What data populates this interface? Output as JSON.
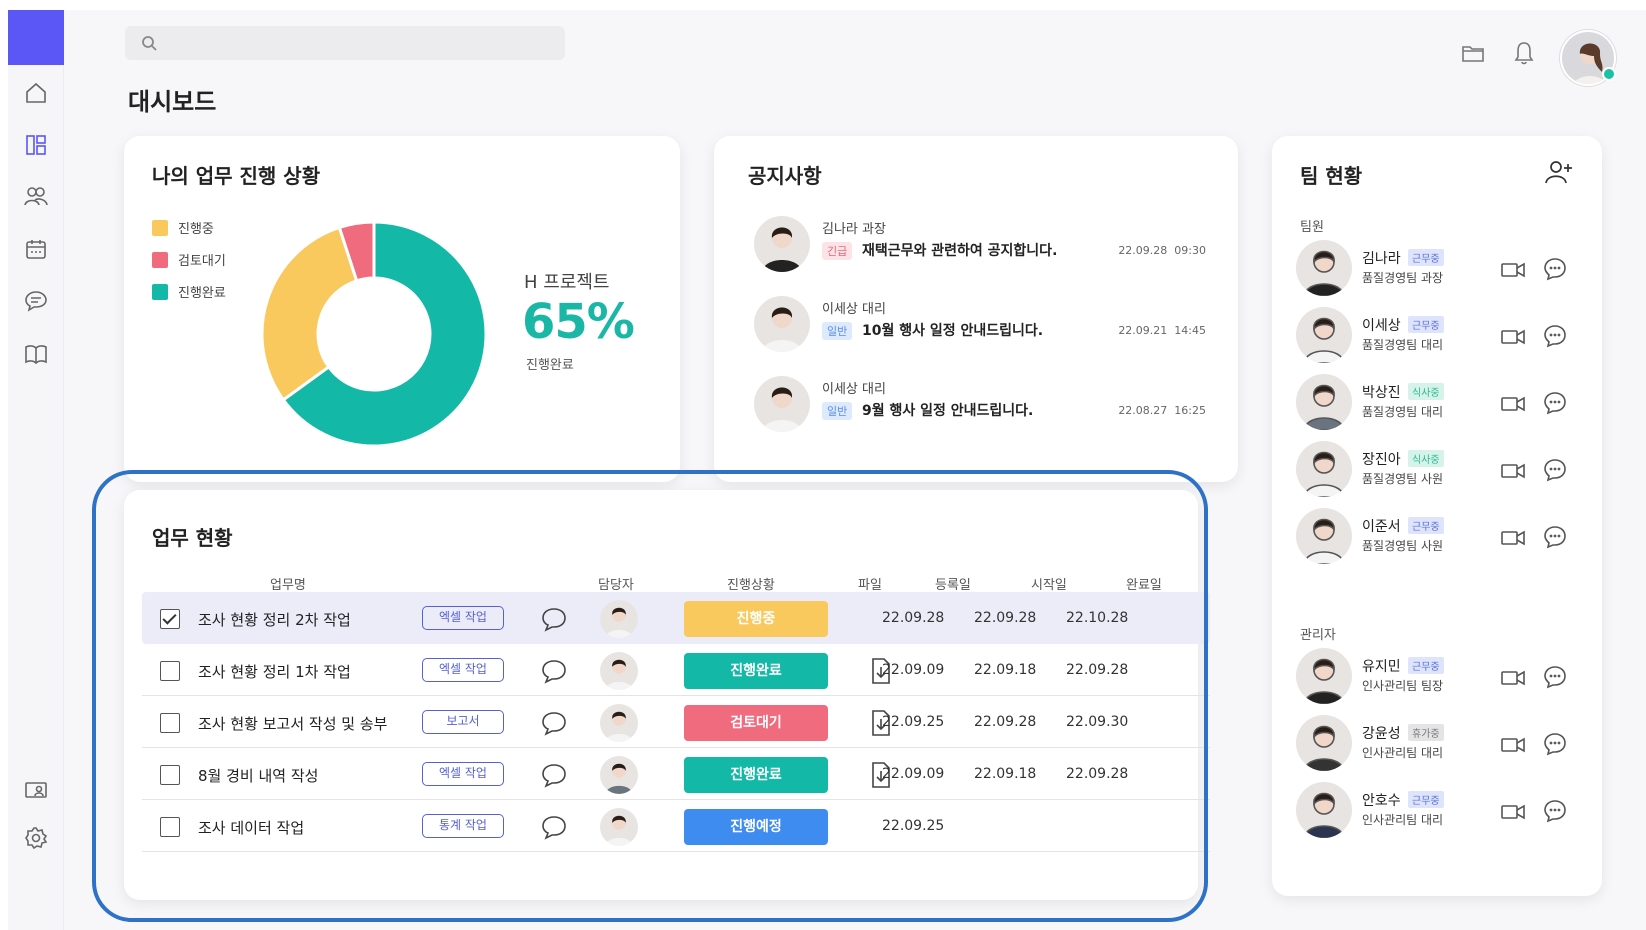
{
  "header": {
    "page_title": "대시보드",
    "search_placeholder": ""
  },
  "sidebar": {
    "items": [
      "home-icon",
      "dashboard-icon",
      "team-icon",
      "calendar-icon",
      "chat-icon",
      "book-icon",
      "monitor-user-icon",
      "settings-icon"
    ],
    "active": "dashboard-icon",
    "accent": "#5b57f6"
  },
  "progress": {
    "title": "나의 업무 진행 상황",
    "legend": [
      {
        "label": "진행중",
        "color": "#f9c95e"
      },
      {
        "label": "검토대기",
        "color": "#f06b7e"
      },
      {
        "label": "진행완료",
        "color": "#13b8a6"
      }
    ],
    "project_name": "H 프로젝트",
    "percent": "65%",
    "percent_label": "진행완료",
    "slices": [
      {
        "label": "진행완료",
        "value": 65,
        "color": "#13b8a6"
      },
      {
        "label": "진행중",
        "value": 30,
        "color": "#f9c95e"
      },
      {
        "label": "검토대기",
        "value": 5,
        "color": "#f06b7e"
      }
    ]
  },
  "notices": {
    "title": "공지사항",
    "items": [
      {
        "author": "김나라 과장",
        "tag": "긴급",
        "tag_type": "urgent",
        "message": "재택근무와 관련하여 공지합니다.",
        "date": "22.09.28",
        "time": "09:30"
      },
      {
        "author": "이세상 대리",
        "tag": "일반",
        "tag_type": "normal",
        "message": "10월 행사 일정 안내드립니다.",
        "date": "22.09.21",
        "time": "14:45"
      },
      {
        "author": "이세상 대리",
        "tag": "일반",
        "tag_type": "normal",
        "message": "9월 행사 일정 안내드립니다.",
        "date": "22.08.27",
        "time": "16:25"
      }
    ]
  },
  "team": {
    "title": "팀 현황",
    "section_members": "팀원",
    "section_managers": "관리자",
    "members": [
      {
        "name": "김나라",
        "status": "근무중",
        "status_type": "work",
        "dept": "품질경영팀 과장"
      },
      {
        "name": "이세상",
        "status": "근무중",
        "status_type": "work",
        "dept": "품질경영팀 대리"
      },
      {
        "name": "박상진",
        "status": "식사중",
        "status_type": "meal",
        "dept": "품질경영팀 대리"
      },
      {
        "name": "장진아",
        "status": "식사중",
        "status_type": "meal",
        "dept": "품질경영팀 사원"
      },
      {
        "name": "이준서",
        "status": "근무중",
        "status_type": "work",
        "dept": "품질경영팀 사원"
      }
    ],
    "managers": [
      {
        "name": "유지민",
        "status": "근무중",
        "status_type": "work",
        "dept": "인사관리팀 팀장"
      },
      {
        "name": "강윤성",
        "status": "휴가중",
        "status_type": "off",
        "dept": "인사관리팀 대리"
      },
      {
        "name": "안호수",
        "status": "근무중",
        "status_type": "work",
        "dept": "인사관리팀 대리"
      }
    ]
  },
  "tasks": {
    "title": "업무 현황",
    "columns": {
      "name": "업무명",
      "assignee": "담당자",
      "status": "진행상황",
      "file": "파일",
      "registered": "등록일",
      "start": "시작일",
      "end": "완료일"
    },
    "rows": [
      {
        "checked": true,
        "name": "조사 현황 정리 2차 작업",
        "tag": "엑셀 작업",
        "status": "진행중",
        "status_color": "#f9c95e",
        "has_file": false,
        "registered": "22.09.28",
        "start": "22.09.28",
        "end": "22.10.28"
      },
      {
        "checked": false,
        "name": "조사 현황 정리 1차 작업",
        "tag": "엑셀 작업",
        "status": "진행완료",
        "status_color": "#13b8a6",
        "has_file": true,
        "registered": "22.09.09",
        "start": "22.09.18",
        "end": "22.09.28"
      },
      {
        "checked": false,
        "name": "조사 현황 보고서 작성 및 송부",
        "tag": "보고서",
        "status": "검토대기",
        "status_color": "#f06b7e",
        "has_file": true,
        "registered": "22.09.25",
        "start": "22.09.28",
        "end": "22.09.30"
      },
      {
        "checked": false,
        "name": "8월 경비 내역 작성",
        "tag": "엑셀 작업",
        "status": "진행완료",
        "status_color": "#13b8a6",
        "has_file": true,
        "registered": "22.09.09",
        "start": "22.09.18",
        "end": "22.09.28"
      },
      {
        "checked": false,
        "name": "조사 데이터 작업",
        "tag": "통계 작업",
        "status": "진행예정",
        "status_color": "#3f8cf0",
        "has_file": false,
        "registered": "22.09.25",
        "start": "",
        "end": ""
      }
    ]
  }
}
